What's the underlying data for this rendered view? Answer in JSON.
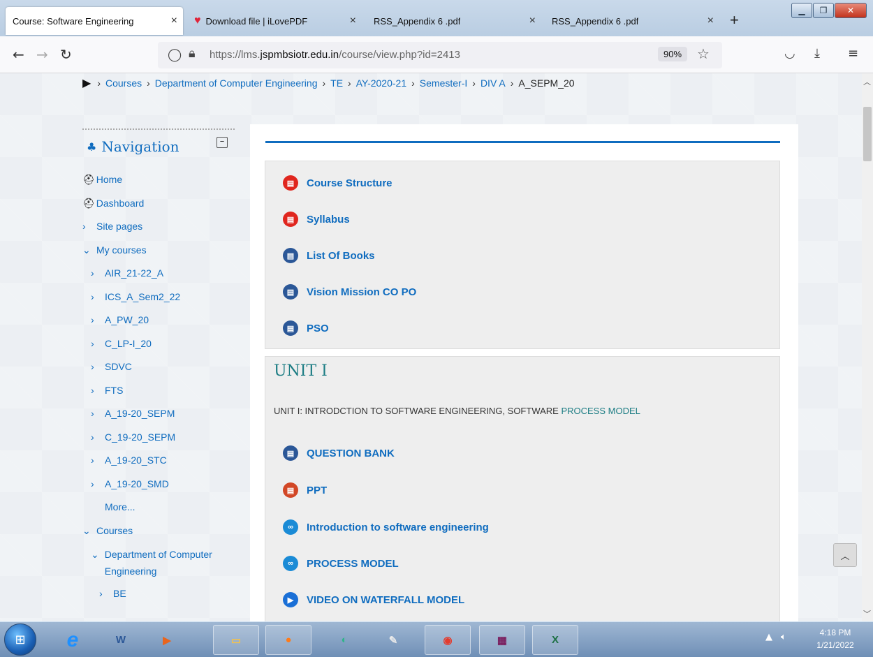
{
  "tabs": [
    {
      "title": "Course: Software Engineering",
      "close": "×"
    },
    {
      "title": "Download file | iLovePDF",
      "close": "×"
    },
    {
      "title": "RSS_Appendix 6 .pdf",
      "close": "×"
    },
    {
      "title": "RSS_Appendix 6 .pdf",
      "close": "×"
    }
  ],
  "newtab": "+",
  "url": {
    "prefix": "https://lms.",
    "domain": "jspmbsiotr.edu.in",
    "path": "/course/view.php?id=2413"
  },
  "zoom": "90%",
  "breadcrumb": [
    "Courses",
    "Department of Computer Engineering",
    "TE",
    "AY-2020-21",
    "Semester-I",
    "DIV A",
    "A_SEPM_20"
  ],
  "navigation": {
    "title": "Navigation",
    "items": [
      {
        "label": "Home",
        "icon": "dashboard-icon",
        "chev": ""
      },
      {
        "label": "Dashboard",
        "icon": "dashboard-icon",
        "chev": ""
      },
      {
        "label": "Site pages",
        "icon": "",
        "chev": ">"
      },
      {
        "label": "My courses",
        "icon": "",
        "chev": "v"
      },
      {
        "label": "AIR_21-22_A",
        "icon": "",
        "chev": ">"
      },
      {
        "label": "ICS_A_Sem2_22",
        "icon": "",
        "chev": ">"
      },
      {
        "label": "A_PW_20",
        "icon": "",
        "chev": ">"
      },
      {
        "label": "C_LP-I_20",
        "icon": "",
        "chev": ">"
      },
      {
        "label": "SDVC",
        "icon": "",
        "chev": ">"
      },
      {
        "label": "FTS",
        "icon": "",
        "chev": ">"
      },
      {
        "label": "A_19-20_SEPM",
        "icon": "",
        "chev": ">"
      },
      {
        "label": "C_19-20_SEPM",
        "icon": "",
        "chev": ">"
      },
      {
        "label": "A_19-20_STC",
        "icon": "",
        "chev": ">"
      },
      {
        "label": "A_19-20_SMD",
        "icon": "",
        "chev": ">"
      },
      {
        "label": "More...",
        "icon": "",
        "chev": ""
      },
      {
        "label": "Courses",
        "icon": "",
        "chev": "v"
      },
      {
        "label": "Department of Computer Engineering",
        "icon": "",
        "chev": "v"
      },
      {
        "label": "BE",
        "icon": "",
        "chev": ">"
      }
    ]
  },
  "section1": {
    "activities": [
      {
        "label": "Course Structure",
        "type": "pdf"
      },
      {
        "label": "Syllabus",
        "type": "pdf"
      },
      {
        "label": "List Of Books",
        "type": "doc"
      },
      {
        "label": "Vision Mission CO PO",
        "type": "doc"
      },
      {
        "label": "PSO",
        "type": "doc"
      }
    ]
  },
  "unit1": {
    "title": "UNIT I",
    "desc_main": "UNIT I: INTRODCTION TO SOFTWARE ENGINEERING, SOFTWARE ",
    "desc_highlight": "PROCESS MODEL",
    "activities": [
      {
        "label": "QUESTION BANK",
        "type": "doc"
      },
      {
        "label": "PPT",
        "type": "ppt"
      },
      {
        "label": "Introduction to software engineering",
        "type": "link"
      },
      {
        "label": "PROCESS MODEL",
        "type": "link"
      },
      {
        "label": "VIDEO ON WATERFALL MODEL",
        "type": "video"
      }
    ]
  },
  "taskbar": {
    "apps": [
      "ie-icon",
      "word-icon",
      "player-icon",
      "explorer-icon",
      "firefox-icon",
      "edge-icon",
      "paint-icon",
      "chrome-icon",
      "winrar-icon",
      "excel-icon"
    ],
    "time": "4:18 PM",
    "date": "1/21/2022"
  },
  "colors": {
    "accent": "#0f6cbf",
    "unit": "#1b7c83",
    "pdf": "#e0261e",
    "doc": "#2b5797"
  }
}
